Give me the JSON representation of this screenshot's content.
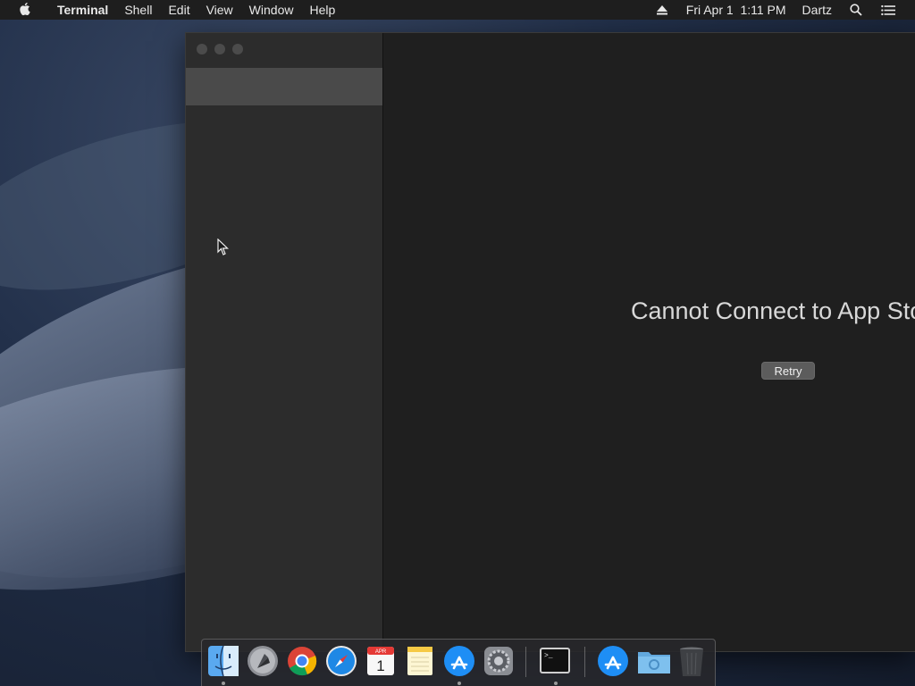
{
  "menubar": {
    "app_name": "Terminal",
    "menus": [
      "Shell",
      "Edit",
      "View",
      "Window",
      "Help"
    ],
    "datetime": "Fri Apr 1  1:11 PM",
    "user": "Dartz"
  },
  "window": {
    "error_title": "Cannot Connect to App Store",
    "retry_label": "Retry"
  },
  "dock": {
    "items": [
      "finder-icon",
      "launchpad-icon",
      "chrome-icon",
      "safari-icon",
      "calendar-icon",
      "notes-icon",
      "app-store-icon",
      "system-preferences-icon",
      "terminal-icon",
      "app-store-folder-icon",
      "downloads-folder-icon",
      "trash-icon"
    ],
    "calendar_month": "APR",
    "calendar_day": "1",
    "terminal_prompt": ">_"
  },
  "colors": {
    "menubar_bg": "#1e1e1e",
    "window_bg": "#1f1f1f",
    "sidebar_bg": "#2c2c2c"
  }
}
